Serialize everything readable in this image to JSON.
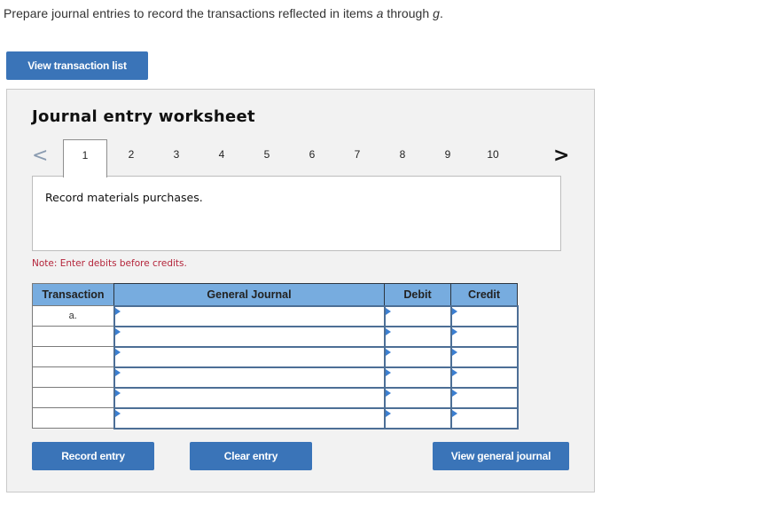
{
  "instructions": {
    "prefix": "Prepare journal entries to record the transactions reflected in items ",
    "item_start": "a",
    "middle": " through ",
    "item_end": "g",
    "suffix": "."
  },
  "view_transaction_list_label": "View transaction list",
  "worksheet": {
    "title": "Journal entry worksheet",
    "prev_icon": "chevron-left-icon",
    "next_icon": "chevron-right-icon",
    "prev_glyph": "<",
    "next_glyph": ">",
    "tabs": [
      "1",
      "2",
      "3",
      "4",
      "5",
      "6",
      "7",
      "8",
      "9",
      "10"
    ],
    "active_tab": "1",
    "description": "Record materials purchases.",
    "note": "Note: Enter debits before credits.",
    "table": {
      "headers": {
        "transaction": "Transaction",
        "general_journal": "General Journal",
        "debit": "Debit",
        "credit": "Credit"
      },
      "rows": [
        {
          "transaction": "a.",
          "general_journal": "",
          "debit": "",
          "credit": ""
        },
        {
          "transaction": "",
          "general_journal": "",
          "debit": "",
          "credit": ""
        },
        {
          "transaction": "",
          "general_journal": "",
          "debit": "",
          "credit": ""
        },
        {
          "transaction": "",
          "general_journal": "",
          "debit": "",
          "credit": ""
        },
        {
          "transaction": "",
          "general_journal": "",
          "debit": "",
          "credit": ""
        },
        {
          "transaction": "",
          "general_journal": "",
          "debit": "",
          "credit": ""
        }
      ]
    },
    "buttons": {
      "record_entry": "Record entry",
      "clear_entry": "Clear entry",
      "view_general_journal": "View general journal"
    }
  },
  "colors": {
    "button_blue": "#3a74b8",
    "header_blue": "#77acdf",
    "note_red": "#b4243a",
    "input_border": "#4d6f96"
  }
}
